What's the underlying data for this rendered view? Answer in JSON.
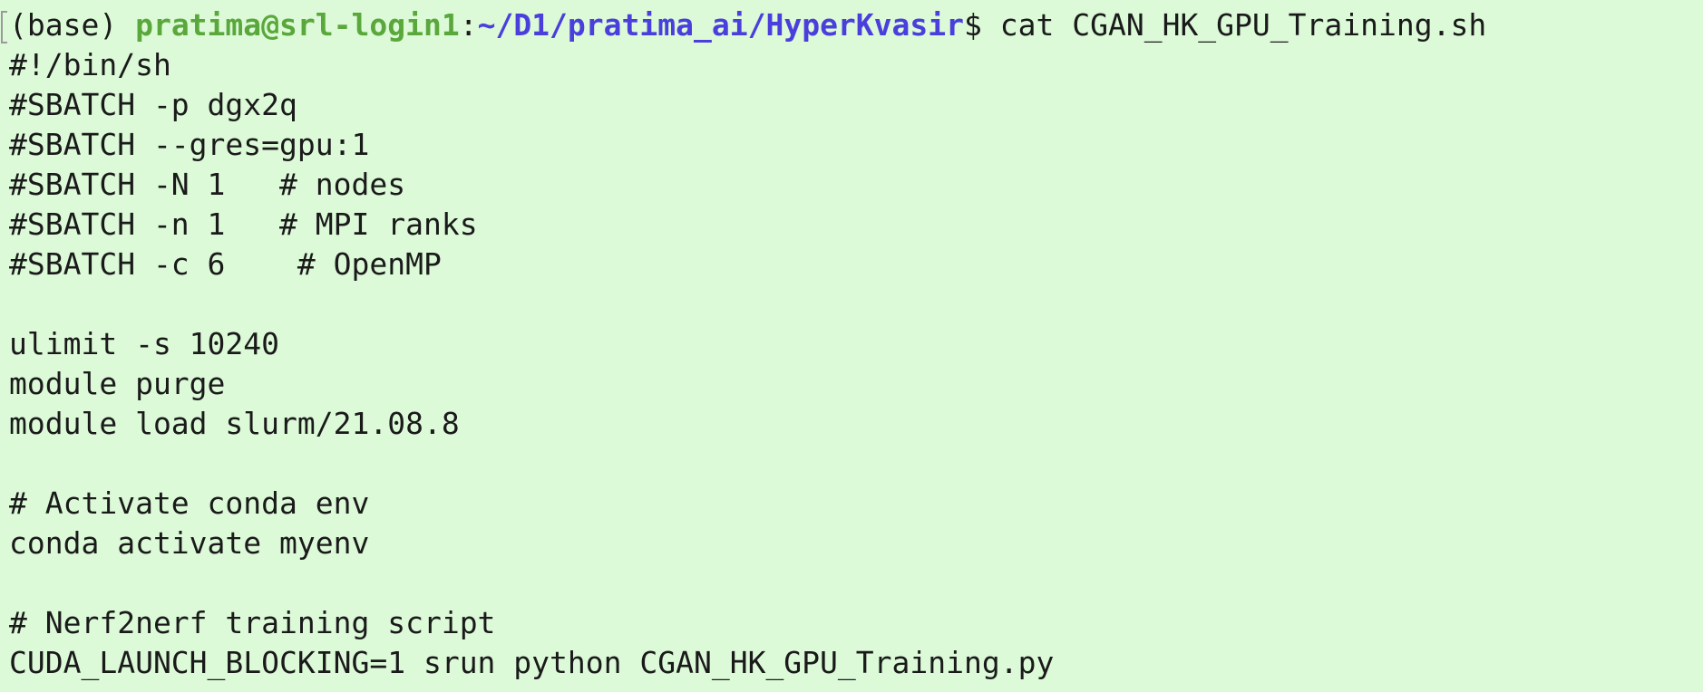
{
  "prompt": {
    "env": "(base) ",
    "user_host": "pratima@srl-login1",
    "separator": ":",
    "path": "~/D1/pratima_ai/HyperKvasir",
    "symbol": "$ ",
    "command": "cat CGAN_HK_GPU_Training.sh"
  },
  "output_lines": [
    "#!/bin/sh",
    "#SBATCH -p dgx2q",
    "#SBATCH --gres=gpu:1",
    "#SBATCH -N 1   # nodes",
    "#SBATCH -n 1   # MPI ranks",
    "#SBATCH -c 6    # OpenMP",
    "",
    "ulimit -s 10240",
    "module purge",
    "module load slurm/21.08.8",
    "",
    "# Activate conda env",
    "conda activate myenv",
    "",
    "# Nerf2nerf training script",
    "CUDA_LAUNCH_BLOCKING=1 srun python CGAN_HK_GPU_Training.py"
  ],
  "colors": {
    "background": "#dcfad8",
    "user_host": "#5aa83b",
    "path": "#4a3fdc",
    "text": "#1a1a1a"
  }
}
